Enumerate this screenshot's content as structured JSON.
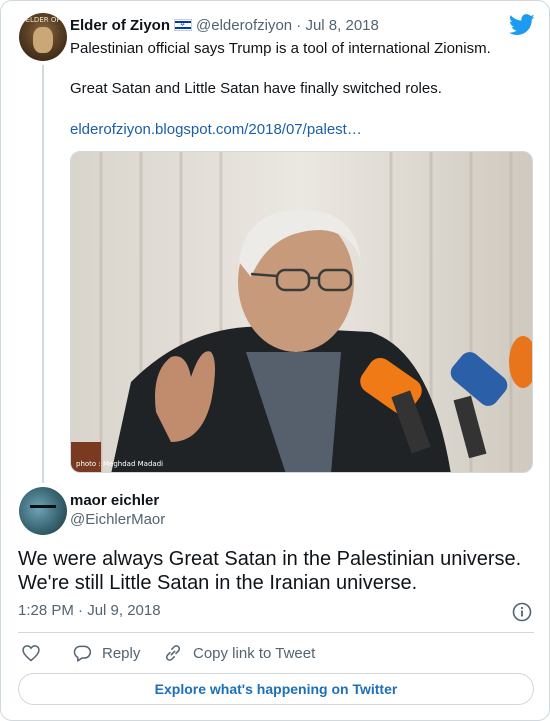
{
  "parent_tweet": {
    "author_name": "Elder of Ziyon",
    "flag_emoji": "israel-flag-icon",
    "handle": "@elderofziyon",
    "separator": "·",
    "date": "Jul 8, 2018",
    "line1": "Palestinian official says Trump is a tool of international Zionism.",
    "line2": "Great Satan and Little Satan have finally switched roles.",
    "link": "elderofziyon.blogspot.com/2018/07/palest…",
    "avatar_text": "ELDER OF",
    "photo_credit": "photo : Meghdad Madadi"
  },
  "reply_tweet": {
    "author_name": "maor eichler",
    "handle": "@EichlerMaor",
    "body_line1": "We were always Great Satan in the Palestinian universe.",
    "body_line2": "We're still Little Satan in the Iranian universe.",
    "timestamp": "1:28 PM · Jul 9, 2018"
  },
  "actions": {
    "reply_label": "Reply",
    "copy_link_label": "Copy link to Tweet"
  },
  "explore_label": "Explore what's happening on Twitter",
  "colors": {
    "twitter_blue": "#1d9bf0",
    "link": "#1b5ea6",
    "muted": "#536471",
    "border": "#cfd9de"
  }
}
